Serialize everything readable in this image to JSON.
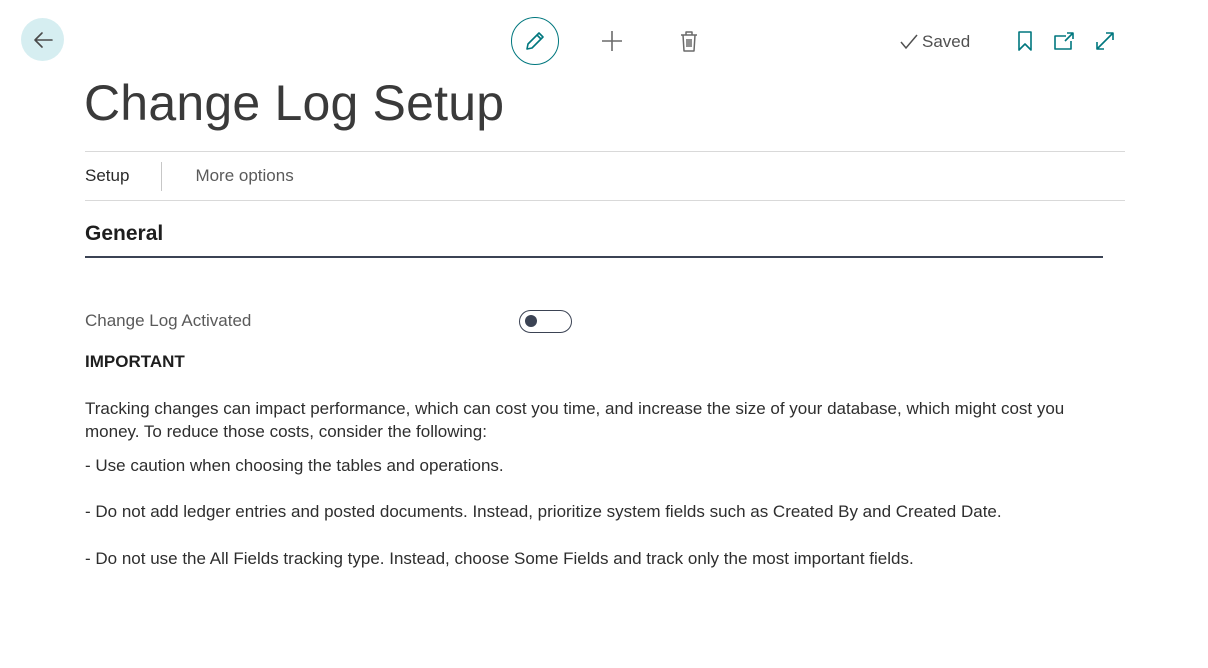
{
  "toolbar": {
    "back_icon": "arrow-left-icon",
    "edit_icon": "pencil-icon",
    "new_icon": "plus-icon",
    "delete_icon": "trash-icon",
    "saved_label": "Saved",
    "bookmark_icon": "bookmark-icon",
    "popout_icon": "open-in-new-window-icon",
    "expand_icon": "expand-icon"
  },
  "page": {
    "title": "Change Log Setup"
  },
  "menu": {
    "items": [
      {
        "label": "Setup"
      },
      {
        "label": "More options"
      }
    ]
  },
  "general": {
    "header": "General",
    "change_log_activated_label": "Change Log Activated",
    "change_log_activated_value": false,
    "important_heading": "IMPORTANT",
    "intro": "Tracking changes can impact performance, which can cost you time, and increase the size of your database, which might cost you money. To reduce those costs, consider the following:",
    "bullets": [
      "- Use caution when choosing the tables and operations.",
      "- Do not add ledger entries and posted documents. Instead, prioritize system fields such as Created By and Created Date.",
      "- Do not use the All Fields tracking type. Instead, choose Some Fields and track only the most important fields."
    ]
  },
  "colors": {
    "accent": "#00777e",
    "back_button_bg": "#d6eef1",
    "section_rule": "#3b4354"
  }
}
